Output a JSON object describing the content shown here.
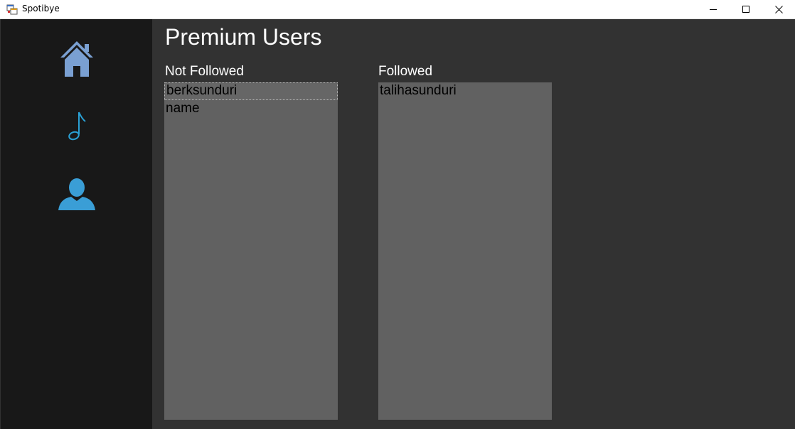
{
  "window": {
    "title": "Spotibye",
    "icon": "app-window-icon",
    "controls": [
      "minimize-icon",
      "maximize-icon",
      "close-icon"
    ]
  },
  "sidebar": {
    "background": "#181818",
    "items": [
      {
        "icon": "home-icon",
        "color": "#7aa0d2"
      },
      {
        "icon": "music-note-icon",
        "color": "#2aa0d4"
      },
      {
        "icon": "user-icon",
        "color": "#3a9ed6"
      }
    ]
  },
  "main": {
    "title": "Premium Users",
    "not_followed": {
      "label": "Not Followed",
      "items": [
        "berksunduri",
        "name"
      ]
    },
    "followed": {
      "label": "Followed",
      "items": [
        "talihasunduri"
      ]
    }
  },
  "colors": {
    "main_background": "#323232",
    "listbox_background": "#616161",
    "text_primary": "#ffffff"
  }
}
